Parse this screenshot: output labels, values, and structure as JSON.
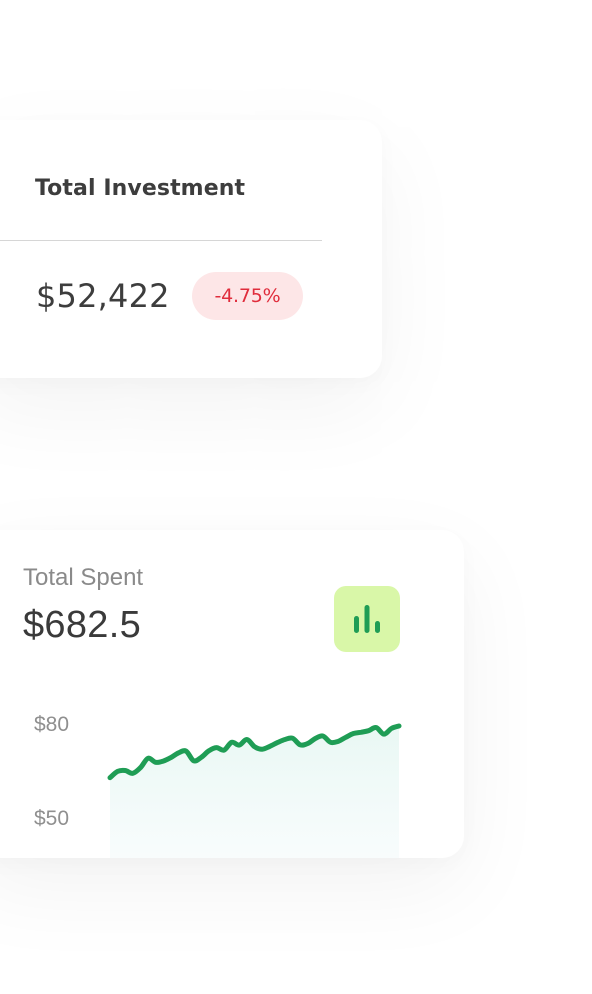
{
  "investment": {
    "title": "Total Investment",
    "amount": "$52,422",
    "change": "-4.75%",
    "change_color": "#e02d3c",
    "change_bg": "#fde6e7"
  },
  "spent": {
    "label": "Total Spent",
    "amount": "$682.5",
    "chart_button_icon": "bar-chart-icon",
    "chart_button_bg": "#d9f7a8",
    "accent": "#1f9d55",
    "y_ticks": [
      "$80",
      "$50"
    ]
  },
  "chart_data": {
    "type": "line",
    "title": "",
    "xlabel": "",
    "ylabel": "",
    "ylim": [
      44,
      92
    ],
    "grid": false,
    "legend": "none",
    "y_tick_labels": [
      "$80",
      "$50"
    ],
    "series": [
      {
        "values": [
          63.5,
          65.5,
          65.8,
          64.9,
          66.7,
          69.7,
          68.4,
          68.8,
          69.9,
          71.4,
          72.0,
          68.9,
          70.0,
          72.1,
          73.1,
          72.3,
          74.8,
          73.9,
          75.7,
          73.4,
          72.6,
          73.5,
          74.7,
          75.7,
          76.1,
          74.0,
          74.4,
          76.0,
          76.8,
          74.8,
          75.1,
          76.4,
          77.6,
          78.0,
          78.5,
          79.5,
          77.4,
          79.2,
          80.0
        ]
      }
    ]
  }
}
